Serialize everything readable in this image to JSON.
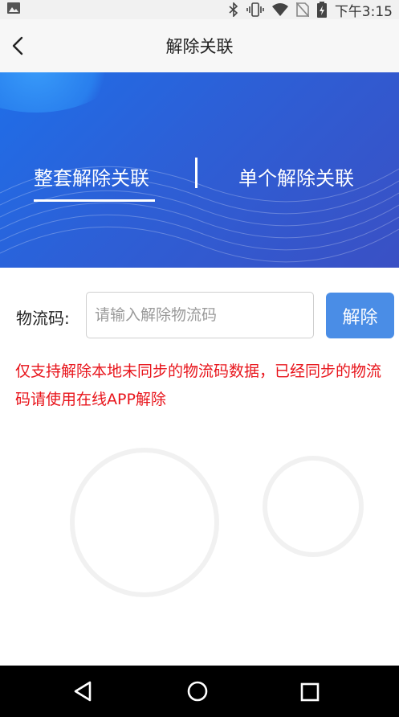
{
  "status_bar": {
    "time": "下午3:15",
    "icons": [
      "image-icon",
      "bluetooth-icon",
      "vibrate-icon",
      "wifi-icon",
      "no-sim-icon",
      "battery-charging-icon"
    ]
  },
  "header": {
    "title": "解除关联",
    "back_icon": "chevron-left-icon"
  },
  "tabs": [
    {
      "label": "整套解除关联",
      "active": true
    },
    {
      "label": "单个解除关联",
      "active": false
    }
  ],
  "form": {
    "label": "物流码:",
    "input_placeholder": "请输入解除物流码",
    "input_value": "",
    "button_label": "解除"
  },
  "notice": "仅支持解除本地未同步的物流码数据，已经同步的物流码请使用在线APP解除",
  "colors": {
    "banner": "#2d5fd6",
    "button": "#4a8de6",
    "notice": "#e8141b"
  },
  "nav_bar": {
    "icons": [
      "nav-back-icon",
      "nav-home-icon",
      "nav-recent-icon"
    ]
  }
}
